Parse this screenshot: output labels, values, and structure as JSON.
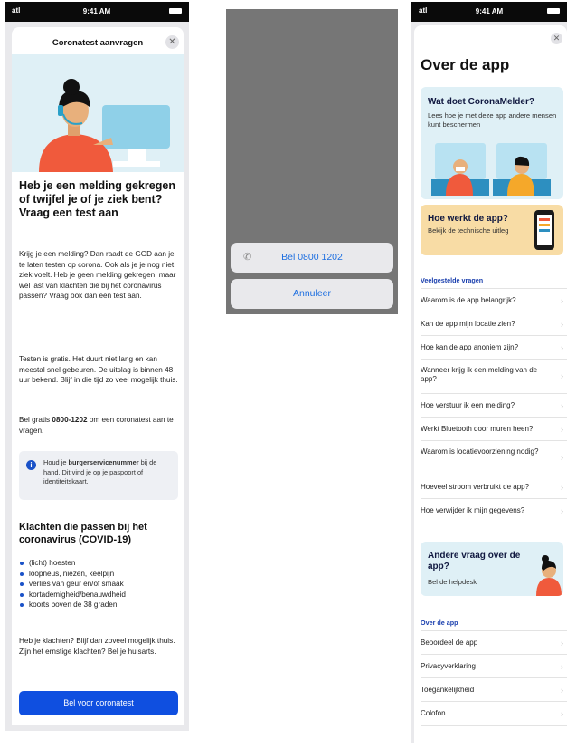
{
  "status": {
    "time": "9:41 AM",
    "signal": "atl"
  },
  "left": {
    "title": "Coronatest aanvragen",
    "close": "✕",
    "heading": "Heb je een melding gekregen of twijfel je of je ziek bent? Vraag een test aan",
    "p1": "Krijg je een melding? Dan raadt de GGD aan je te laten testen op corona. Ook als je je nog niet ziek voelt. Heb je geen melding gekregen, maar wel last van klachten die bij het coronavirus passen? Vraag ook dan een test aan.",
    "p2": "Testen is gratis. Het duurt niet lang en kan meestal snel gebeuren. De uitslag is binnen 48 uur bekend. Blijf in die tijd zo veel mogelijk thuis.",
    "p3_pre": "Bel gratis ",
    "p3_bold": "0800-1202",
    "p3_post": " om een coronatest aan te vragen.",
    "info_pre": "Houd je ",
    "info_bold": "burgerservicenummer",
    "info_post": " bij de hand. Dit vind je op je paspoort of identiteitskaart.",
    "h2": "Klachten die passen bij het coronavirus (COVID-19)",
    "bullets": [
      "(licht) hoesten",
      "loopneus, niezen, keelpijn",
      "verlies van geur en/of smaak",
      "kortademigheid/benauwdheid",
      "koorts boven de 38 graden"
    ],
    "p4": "Heb je klachten? Blijf dan zoveel mogelijk thuis. Zijn het ernstige klachten? Bel je huisarts.",
    "cta": "Bel voor coronatest"
  },
  "mid": {
    "call": "Bel 0800 1202",
    "cancel": "Annuleer"
  },
  "right": {
    "title": "Over de app",
    "card1_title": "Wat doet CoronaMelder?",
    "card1_sub": "Lees hoe je met deze app andere mensen kunt beschermen",
    "card2_title": "Hoe werkt de app?",
    "card2_sub": "Bekijk de technische uitleg",
    "faq_header": "Veelgestelde vragen",
    "faq": [
      "Waarom is de app belangrijk?",
      "Kan de app mijn locatie zien?",
      "Hoe kan de app anoniem zijn?",
      "Wanneer krijg ik een melding van de app?",
      "Hoe verstuur ik een melding?",
      "Werkt Bluetooth door muren heen?",
      "Waarom is locatievoorziening nodig?",
      "Hoeveel stroom verbruikt de app?",
      "Hoe verwijder ik mijn gegevens?"
    ],
    "help_title": "Andere vraag over de app?",
    "help_sub": "Bel de helpdesk",
    "about_header": "Over de app",
    "about": [
      "Beoordeel de app",
      "Privacyverklaring",
      "Toegankelijkheid",
      "Colofon"
    ]
  },
  "colors": {
    "primary": "#0f4fe0",
    "link": "#1e6fe0",
    "card": "#dff0f6",
    "card_orange": "#f8dca5"
  }
}
